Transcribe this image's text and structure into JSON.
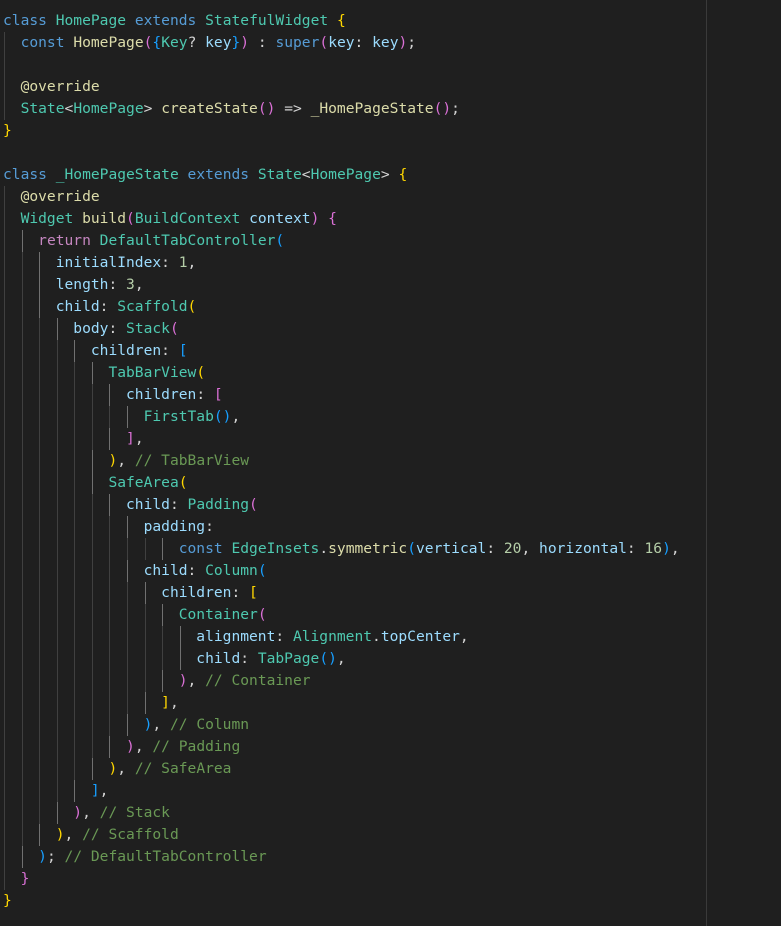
{
  "editor": {
    "language": "dart",
    "colors": {
      "background": "#1f1f1f",
      "keyword": "#569cd6",
      "control": "#c586c0",
      "class": "#4ec9b0",
      "function": "#dcdcaa",
      "param": "#9cdcfe",
      "number": "#b5cea8",
      "comment": "#6a9955",
      "plain": "#d4d4d4",
      "bracket_1": "#ffd700",
      "bracket_2": "#da70d6",
      "bracket_3": "#179fff"
    },
    "lines": [
      {
        "indent": 0,
        "tokens": [
          [
            "kw",
            "class"
          ],
          [
            "pl",
            " "
          ],
          [
            "cls",
            "HomePage"
          ],
          [
            "pl",
            " "
          ],
          [
            "kw",
            "extends"
          ],
          [
            "pl",
            " "
          ],
          [
            "cls",
            "StatefulWidget"
          ],
          [
            "pl",
            " "
          ],
          [
            "b1",
            "{"
          ]
        ]
      },
      {
        "indent": 1,
        "tokens": [
          [
            "kw",
            "const"
          ],
          [
            "pl",
            " "
          ],
          [
            "fn",
            "HomePage"
          ],
          [
            "b2",
            "("
          ],
          [
            "b3",
            "{"
          ],
          [
            "cls",
            "Key"
          ],
          [
            "pl",
            "? "
          ],
          [
            "prm",
            "key"
          ],
          [
            "b3",
            "}"
          ],
          [
            "b2",
            ")"
          ],
          [
            "pl",
            " : "
          ],
          [
            "kw",
            "super"
          ],
          [
            "b2",
            "("
          ],
          [
            "prm",
            "key"
          ],
          [
            "pl",
            ": "
          ],
          [
            "prm",
            "key"
          ],
          [
            "b2",
            ")"
          ],
          [
            "pl",
            ";"
          ]
        ]
      },
      {
        "indent": 1,
        "tokens": []
      },
      {
        "indent": 1,
        "tokens": [
          [
            "fn",
            "@override"
          ]
        ]
      },
      {
        "indent": 1,
        "tokens": [
          [
            "cls",
            "State"
          ],
          [
            "pl",
            "<"
          ],
          [
            "cls",
            "HomePage"
          ],
          [
            "pl",
            "> "
          ],
          [
            "fn",
            "createState"
          ],
          [
            "b2",
            "()"
          ],
          [
            "pl",
            " => "
          ],
          [
            "fn",
            "_HomePageState"
          ],
          [
            "b2",
            "()"
          ],
          [
            "pl",
            ";"
          ]
        ]
      },
      {
        "indent": 0,
        "tokens": [
          [
            "b1",
            "}"
          ]
        ]
      },
      {
        "indent": 0,
        "tokens": []
      },
      {
        "indent": 0,
        "tokens": [
          [
            "kw",
            "class"
          ],
          [
            "pl",
            " "
          ],
          [
            "cls",
            "_HomePageState"
          ],
          [
            "pl",
            " "
          ],
          [
            "kw",
            "extends"
          ],
          [
            "pl",
            " "
          ],
          [
            "cls",
            "State"
          ],
          [
            "pl",
            "<"
          ],
          [
            "cls",
            "HomePage"
          ],
          [
            "pl",
            "> "
          ],
          [
            "b1",
            "{"
          ]
        ]
      },
      {
        "indent": 1,
        "tokens": [
          [
            "fn",
            "@override"
          ]
        ]
      },
      {
        "indent": 1,
        "tokens": [
          [
            "cls",
            "Widget"
          ],
          [
            "pl",
            " "
          ],
          [
            "fn",
            "build"
          ],
          [
            "b2",
            "("
          ],
          [
            "cls",
            "BuildContext"
          ],
          [
            "pl",
            " "
          ],
          [
            "prm",
            "context"
          ],
          [
            "b2",
            ")"
          ],
          [
            "pl",
            " "
          ],
          [
            "b2",
            "{"
          ]
        ]
      },
      {
        "indent": 2,
        "tokens": [
          [
            "ctl",
            "return"
          ],
          [
            "pl",
            " "
          ],
          [
            "cls",
            "DefaultTabController"
          ],
          [
            "b3",
            "("
          ]
        ]
      },
      {
        "indent": 3,
        "tokens": [
          [
            "prm",
            "initialIndex"
          ],
          [
            "pl",
            ": "
          ],
          [
            "num",
            "1"
          ],
          [
            "pl",
            ","
          ]
        ]
      },
      {
        "indent": 3,
        "tokens": [
          [
            "prm",
            "length"
          ],
          [
            "pl",
            ": "
          ],
          [
            "num",
            "3"
          ],
          [
            "pl",
            ","
          ]
        ]
      },
      {
        "indent": 3,
        "tokens": [
          [
            "prm",
            "child"
          ],
          [
            "pl",
            ": "
          ],
          [
            "cls",
            "Scaffold"
          ],
          [
            "b1",
            "("
          ]
        ]
      },
      {
        "indent": 4,
        "tokens": [
          [
            "prm",
            "body"
          ],
          [
            "pl",
            ": "
          ],
          [
            "cls",
            "Stack"
          ],
          [
            "b2",
            "("
          ]
        ]
      },
      {
        "indent": 5,
        "tokens": [
          [
            "prm",
            "children"
          ],
          [
            "pl",
            ": "
          ],
          [
            "b3",
            "["
          ]
        ]
      },
      {
        "indent": 6,
        "tokens": [
          [
            "cls",
            "TabBarView"
          ],
          [
            "b1",
            "("
          ]
        ]
      },
      {
        "indent": 7,
        "tokens": [
          [
            "prm",
            "children"
          ],
          [
            "pl",
            ": "
          ],
          [
            "b2",
            "["
          ]
        ]
      },
      {
        "indent": 8,
        "tokens": [
          [
            "cls",
            "FirstTab"
          ],
          [
            "b3",
            "()"
          ],
          [
            "pl",
            ","
          ]
        ]
      },
      {
        "indent": 7,
        "tokens": [
          [
            "b2",
            "]"
          ],
          [
            "pl",
            ","
          ]
        ]
      },
      {
        "indent": 6,
        "tokens": [
          [
            "b1",
            ")"
          ],
          [
            "pl",
            ", "
          ],
          [
            "cmt",
            "// TabBarView"
          ]
        ]
      },
      {
        "indent": 6,
        "tokens": [
          [
            "cls",
            "SafeArea"
          ],
          [
            "b1",
            "("
          ]
        ]
      },
      {
        "indent": 7,
        "tokens": [
          [
            "prm",
            "child"
          ],
          [
            "pl",
            ": "
          ],
          [
            "cls",
            "Padding"
          ],
          [
            "b2",
            "("
          ]
        ]
      },
      {
        "indent": 8,
        "tokens": [
          [
            "prm",
            "padding"
          ],
          [
            "pl",
            ":"
          ]
        ]
      },
      {
        "indent": 10,
        "tokens": [
          [
            "kw",
            "const"
          ],
          [
            "pl",
            " "
          ],
          [
            "cls",
            "EdgeInsets"
          ],
          [
            "pl",
            "."
          ],
          [
            "fn",
            "symmetric"
          ],
          [
            "b3",
            "("
          ],
          [
            "prm",
            "vertical"
          ],
          [
            "pl",
            ": "
          ],
          [
            "num",
            "20"
          ],
          [
            "pl",
            ", "
          ],
          [
            "prm",
            "horizontal"
          ],
          [
            "pl",
            ": "
          ],
          [
            "num",
            "16"
          ],
          [
            "b3",
            ")"
          ],
          [
            "pl",
            ","
          ]
        ]
      },
      {
        "indent": 8,
        "tokens": [
          [
            "prm",
            "child"
          ],
          [
            "pl",
            ": "
          ],
          [
            "cls",
            "Column"
          ],
          [
            "b3",
            "("
          ]
        ]
      },
      {
        "indent": 9,
        "tokens": [
          [
            "prm",
            "children"
          ],
          [
            "pl",
            ": "
          ],
          [
            "b1",
            "["
          ]
        ]
      },
      {
        "indent": 10,
        "tokens": [
          [
            "cls",
            "Container"
          ],
          [
            "b2",
            "("
          ]
        ]
      },
      {
        "indent": 11,
        "tokens": [
          [
            "prm",
            "alignment"
          ],
          [
            "pl",
            ": "
          ],
          [
            "cls",
            "Alignment"
          ],
          [
            "pl",
            "."
          ],
          [
            "prm",
            "topCenter"
          ],
          [
            "pl",
            ","
          ]
        ]
      },
      {
        "indent": 11,
        "tokens": [
          [
            "prm",
            "child"
          ],
          [
            "pl",
            ": "
          ],
          [
            "cls",
            "TabPage"
          ],
          [
            "b3",
            "()"
          ],
          [
            "pl",
            ","
          ]
        ]
      },
      {
        "indent": 10,
        "tokens": [
          [
            "b2",
            ")"
          ],
          [
            "pl",
            ", "
          ],
          [
            "cmt",
            "// Container"
          ]
        ]
      },
      {
        "indent": 9,
        "tokens": [
          [
            "b1",
            "]"
          ],
          [
            "pl",
            ","
          ]
        ]
      },
      {
        "indent": 8,
        "tokens": [
          [
            "b3",
            ")"
          ],
          [
            "pl",
            ", "
          ],
          [
            "cmt",
            "// Column"
          ]
        ]
      },
      {
        "indent": 7,
        "tokens": [
          [
            "b2",
            ")"
          ],
          [
            "pl",
            ", "
          ],
          [
            "cmt",
            "// Padding"
          ]
        ]
      },
      {
        "indent": 6,
        "tokens": [
          [
            "b1",
            ")"
          ],
          [
            "pl",
            ", "
          ],
          [
            "cmt",
            "// SafeArea"
          ]
        ]
      },
      {
        "indent": 5,
        "tokens": [
          [
            "b3",
            "]"
          ],
          [
            "pl",
            ","
          ]
        ]
      },
      {
        "indent": 4,
        "tokens": [
          [
            "b2",
            ")"
          ],
          [
            "pl",
            ", "
          ],
          [
            "cmt",
            "// Stack"
          ]
        ]
      },
      {
        "indent": 3,
        "tokens": [
          [
            "b1",
            ")"
          ],
          [
            "pl",
            ", "
          ],
          [
            "cmt",
            "// Scaffold"
          ]
        ]
      },
      {
        "indent": 2,
        "tokens": [
          [
            "b3",
            ")"
          ],
          [
            "pl",
            "; "
          ],
          [
            "cmt",
            "// DefaultTabController"
          ]
        ]
      },
      {
        "indent": 1,
        "tokens": [
          [
            "b2",
            "}"
          ]
        ]
      },
      {
        "indent": 0,
        "tokens": [
          [
            "b1",
            "}"
          ]
        ]
      }
    ]
  }
}
